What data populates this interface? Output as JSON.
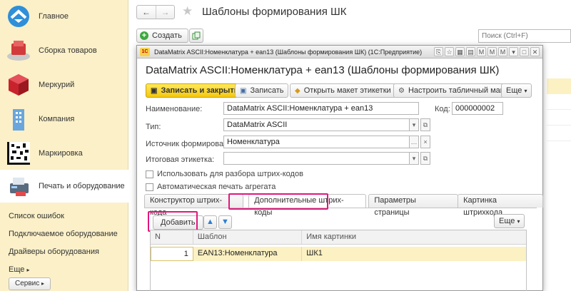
{
  "sidebar": {
    "items": [
      {
        "label": "Главное",
        "icon": "home-icon"
      },
      {
        "label": "Сборка товаров",
        "icon": "assembly-icon"
      },
      {
        "label": "Меркурий",
        "icon": "mercury-cube-icon"
      },
      {
        "label": "Компания",
        "icon": "building-icon"
      },
      {
        "label": "Маркировка",
        "icon": "datamatrix-icon"
      },
      {
        "label": "Печать и оборудование",
        "icon": "printer-icon"
      }
    ],
    "links": [
      "Список ошибок",
      "Подключаемое оборудование",
      "Драйверы оборудования",
      "Еще"
    ],
    "service_label": "Сервис"
  },
  "main": {
    "title": "Шаблоны формирования ШК",
    "create_label": "Создать",
    "search_placeholder": "Поиск (Ctrl+F)"
  },
  "modal": {
    "window_title": "DataMatrix ASCII:Номенклатура + ean13 (Шаблоны формирования ШК)  (1С:Предприятие)",
    "form_title": "DataMatrix ASCII:Номенклатура + ean13 (Шаблоны формирования ШК)",
    "toolbar": {
      "save_close": "Записать и закрыть",
      "save": "Записать",
      "open_layout": "Открыть макет этикетки",
      "configure": "Настроить табличный макет",
      "more": "Еще"
    },
    "fields": {
      "name_label": "Наименование:",
      "name_value": "DataMatrix ASCII:Номенклатура + ean13",
      "code_label": "Код:",
      "code_value": "000000002",
      "type_label": "Тип:",
      "type_value": "DataMatrix ASCII",
      "source_label": "Источник формирования:",
      "source_value": "Номенклатура",
      "final_label": "Итоговая этикетка:",
      "final_value": ""
    },
    "checkboxes": {
      "use_parse": "Использовать для разбора штрих-кодов",
      "auto_print": "Автоматическая печать агрегата"
    },
    "tabs": [
      "Конструктор штрих-кода",
      "Дополнительные штрих-коды",
      "Параметры страницы",
      "Картинка штрихкода"
    ],
    "table": {
      "add_label": "Добавить",
      "more_label": "Еще",
      "headers": [
        "N",
        "Шаблон",
        "Имя картинки"
      ],
      "rows": [
        {
          "n": "1",
          "template": "EAN13:Номенклатура",
          "image": "ШК1"
        }
      ]
    }
  },
  "colors": {
    "highlight": "#e0187d",
    "sidebar": "#fbf0c8",
    "primary": "#f3c70f",
    "selected_row": "#fbf1c2"
  }
}
